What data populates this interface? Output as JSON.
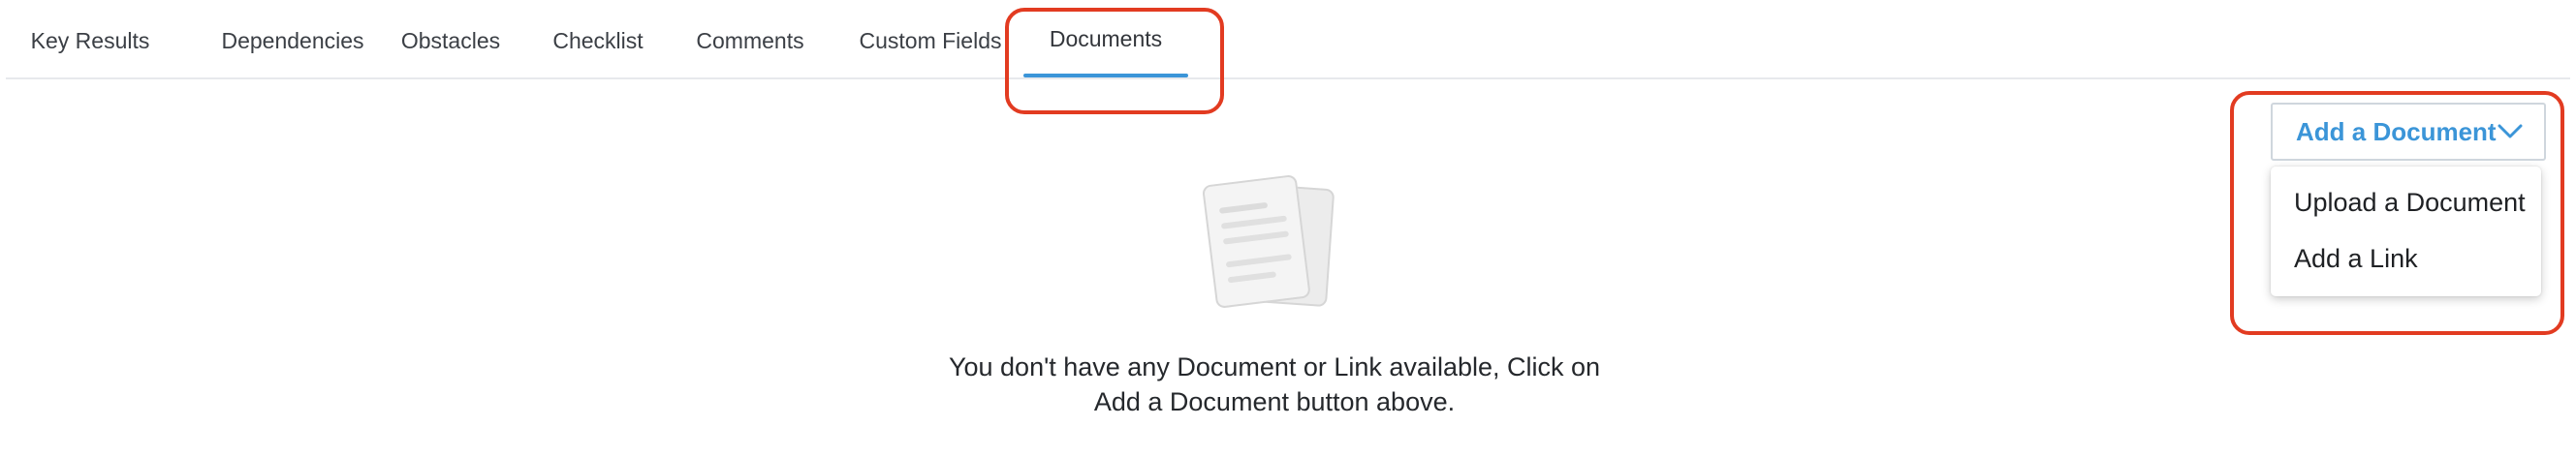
{
  "tabs": [
    {
      "label": "Key Results"
    },
    {
      "label": "Dependencies"
    },
    {
      "label": "Obstacles"
    },
    {
      "label": "Checklist"
    },
    {
      "label": "Comments"
    },
    {
      "label": "Custom Fields"
    },
    {
      "label": "Documents",
      "active": true
    }
  ],
  "add_document": {
    "label": "Add a Document",
    "icon": "chevron-down-icon",
    "menu": [
      {
        "label": "Upload a Document"
      },
      {
        "label": "Add a Link"
      }
    ]
  },
  "empty_state": {
    "icon": "documents-icon",
    "line1": "You don't have any Document or Link available, Click on",
    "line2": "Add a Document button above."
  },
  "colors": {
    "accent": "#3b95d8",
    "highlight": "#e23b21",
    "text": "#3b3f45"
  }
}
